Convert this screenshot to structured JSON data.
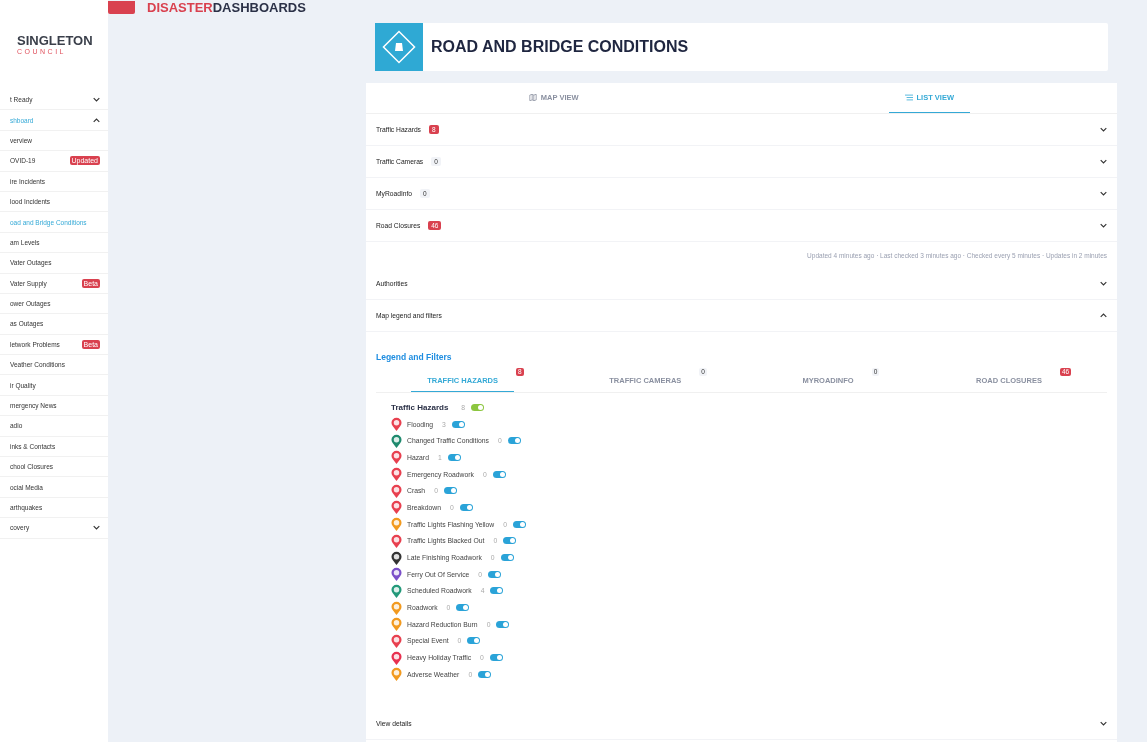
{
  "header": {
    "brand_prefix": "DISASTER",
    "brand_suffix": "DASHBOARDS"
  },
  "sidebar": {
    "logo_name": "SINGLETON",
    "logo_subtitle": "COUNCIL",
    "items": [
      {
        "label": "t Ready",
        "kind": "group",
        "expanded": false,
        "selected": false
      },
      {
        "label": "shboard",
        "kind": "group",
        "expanded": true,
        "selected": true
      },
      {
        "label": "verview",
        "kind": "link",
        "selected": false
      },
      {
        "label": "OVID-19",
        "kind": "link",
        "selected": false,
        "badge": "Updated"
      },
      {
        "label": "ire Incidents",
        "kind": "link",
        "selected": false
      },
      {
        "label": "lood Incidents",
        "kind": "link",
        "selected": false
      },
      {
        "label": "oad and Bridge Conditions",
        "kind": "link",
        "selected": true
      },
      {
        "label": "am Levels",
        "kind": "link",
        "selected": false
      },
      {
        "label": "Vater Outages",
        "kind": "link",
        "selected": false
      },
      {
        "label": "Vater Supply",
        "kind": "link",
        "selected": false,
        "badge": "Beta"
      },
      {
        "label": "ower Outages",
        "kind": "link",
        "selected": false
      },
      {
        "label": "as Outages",
        "kind": "link",
        "selected": false
      },
      {
        "label": "letwork Problems",
        "kind": "link",
        "selected": false,
        "badge": "Beta"
      },
      {
        "label": "Veather Conditions",
        "kind": "link",
        "selected": false
      },
      {
        "label": "ir Quality",
        "kind": "link",
        "selected": false
      },
      {
        "label": "mergency News",
        "kind": "link",
        "selected": false
      },
      {
        "label": "adio",
        "kind": "link",
        "selected": false
      },
      {
        "label": "inks & Contacts",
        "kind": "link",
        "selected": false
      },
      {
        "label": "chool Closures",
        "kind": "link",
        "selected": false
      },
      {
        "label": "ocial Media",
        "kind": "link",
        "selected": false
      },
      {
        "label": "arthquakes",
        "kind": "link",
        "selected": false
      },
      {
        "label": "covery",
        "kind": "group",
        "expanded": false,
        "selected": false
      }
    ]
  },
  "page": {
    "title": "ROAD AND BRIDGE CONDITIONS",
    "view_tabs": [
      {
        "label": "MAP VIEW",
        "kind": "map",
        "selected": false
      },
      {
        "label": "LIST VIEW",
        "kind": "list",
        "selected": true
      }
    ],
    "blocks": [
      {
        "kind": "accordion",
        "label": "Traffic Hazards",
        "count": "8",
        "alert": true,
        "expanded": false
      },
      {
        "kind": "accordion",
        "label": "Traffic Cameras",
        "count": "0",
        "alert": false,
        "expanded": false
      },
      {
        "kind": "accordion",
        "label": "MyRoadInfo",
        "count": "0",
        "alert": false,
        "expanded": false
      },
      {
        "kind": "accordion",
        "label": "Road Closures",
        "count": "46",
        "alert": true,
        "expanded": false
      },
      {
        "kind": "note",
        "text": "Updated 4 minutes ago · Last checked 3 minutes ago · Checked every 5 minutes · Updates in 2 minutes"
      },
      {
        "kind": "accordion",
        "label": "Authorities",
        "expanded": false
      },
      {
        "kind": "accordion",
        "label": "Map legend and filters",
        "expanded": true
      },
      {
        "kind": "legend",
        "title": "Legend and Filters",
        "tabs": [
          {
            "label": "TRAFFIC HAZARDS",
            "count": "8",
            "alert": true,
            "selected": true
          },
          {
            "label": "TRAFFIC CAMERAS",
            "count": "0",
            "alert": false,
            "selected": false
          },
          {
            "label": "MYROADINFO",
            "count": "0",
            "alert": false,
            "selected": false
          },
          {
            "label": "ROAD CLOSURES",
            "count": "46",
            "alert": true,
            "selected": false
          }
        ],
        "group": {
          "label": "Traffic Hazards",
          "count": "8",
          "on": true
        },
        "items": [
          {
            "label": "Flooding",
            "count": "3",
            "color": "#e8404f",
            "on": true
          },
          {
            "label": "Changed Traffic Conditions",
            "count": "0",
            "color": "#1f8a6e",
            "on": true
          },
          {
            "label": "Hazard",
            "count": "1",
            "color": "#e8404f",
            "on": true
          },
          {
            "label": "Emergency Roadwork",
            "count": "0",
            "color": "#e8404f",
            "on": true
          },
          {
            "label": "Crash",
            "count": "0",
            "color": "#e8404f",
            "on": true
          },
          {
            "label": "Breakdown",
            "count": "0",
            "color": "#e8404f",
            "on": true
          },
          {
            "label": "Traffic Lights Flashing Yellow",
            "count": "0",
            "color": "#f29a1f",
            "on": true
          },
          {
            "label": "Traffic Lights Blacked Out",
            "count": "0",
            "color": "#e8404f",
            "on": true
          },
          {
            "label": "Late Finishing Roadwork",
            "count": "0",
            "color": "#333333",
            "on": true
          },
          {
            "label": "Ferry Out Of Service",
            "count": "0",
            "color": "#7b4fc9",
            "on": true
          },
          {
            "label": "Scheduled Roadwork",
            "count": "4",
            "color": "#23997a",
            "on": true
          },
          {
            "label": "Roadwork",
            "count": "0",
            "color": "#f29a1f",
            "on": true
          },
          {
            "label": "Hazard Reduction Burn",
            "count": "0",
            "color": "#f29a1f",
            "on": true
          },
          {
            "label": "Special Event",
            "count": "0",
            "color": "#e8404f",
            "on": true
          },
          {
            "label": "Heavy Holiday Traffic",
            "count": "0",
            "color": "#e8304f",
            "on": true
          },
          {
            "label": "Adverse Weather",
            "count": "0",
            "color": "#f29a1f",
            "on": true
          }
        ]
      },
      {
        "kind": "accordion",
        "label": "View details",
        "expanded": false
      }
    ]
  }
}
